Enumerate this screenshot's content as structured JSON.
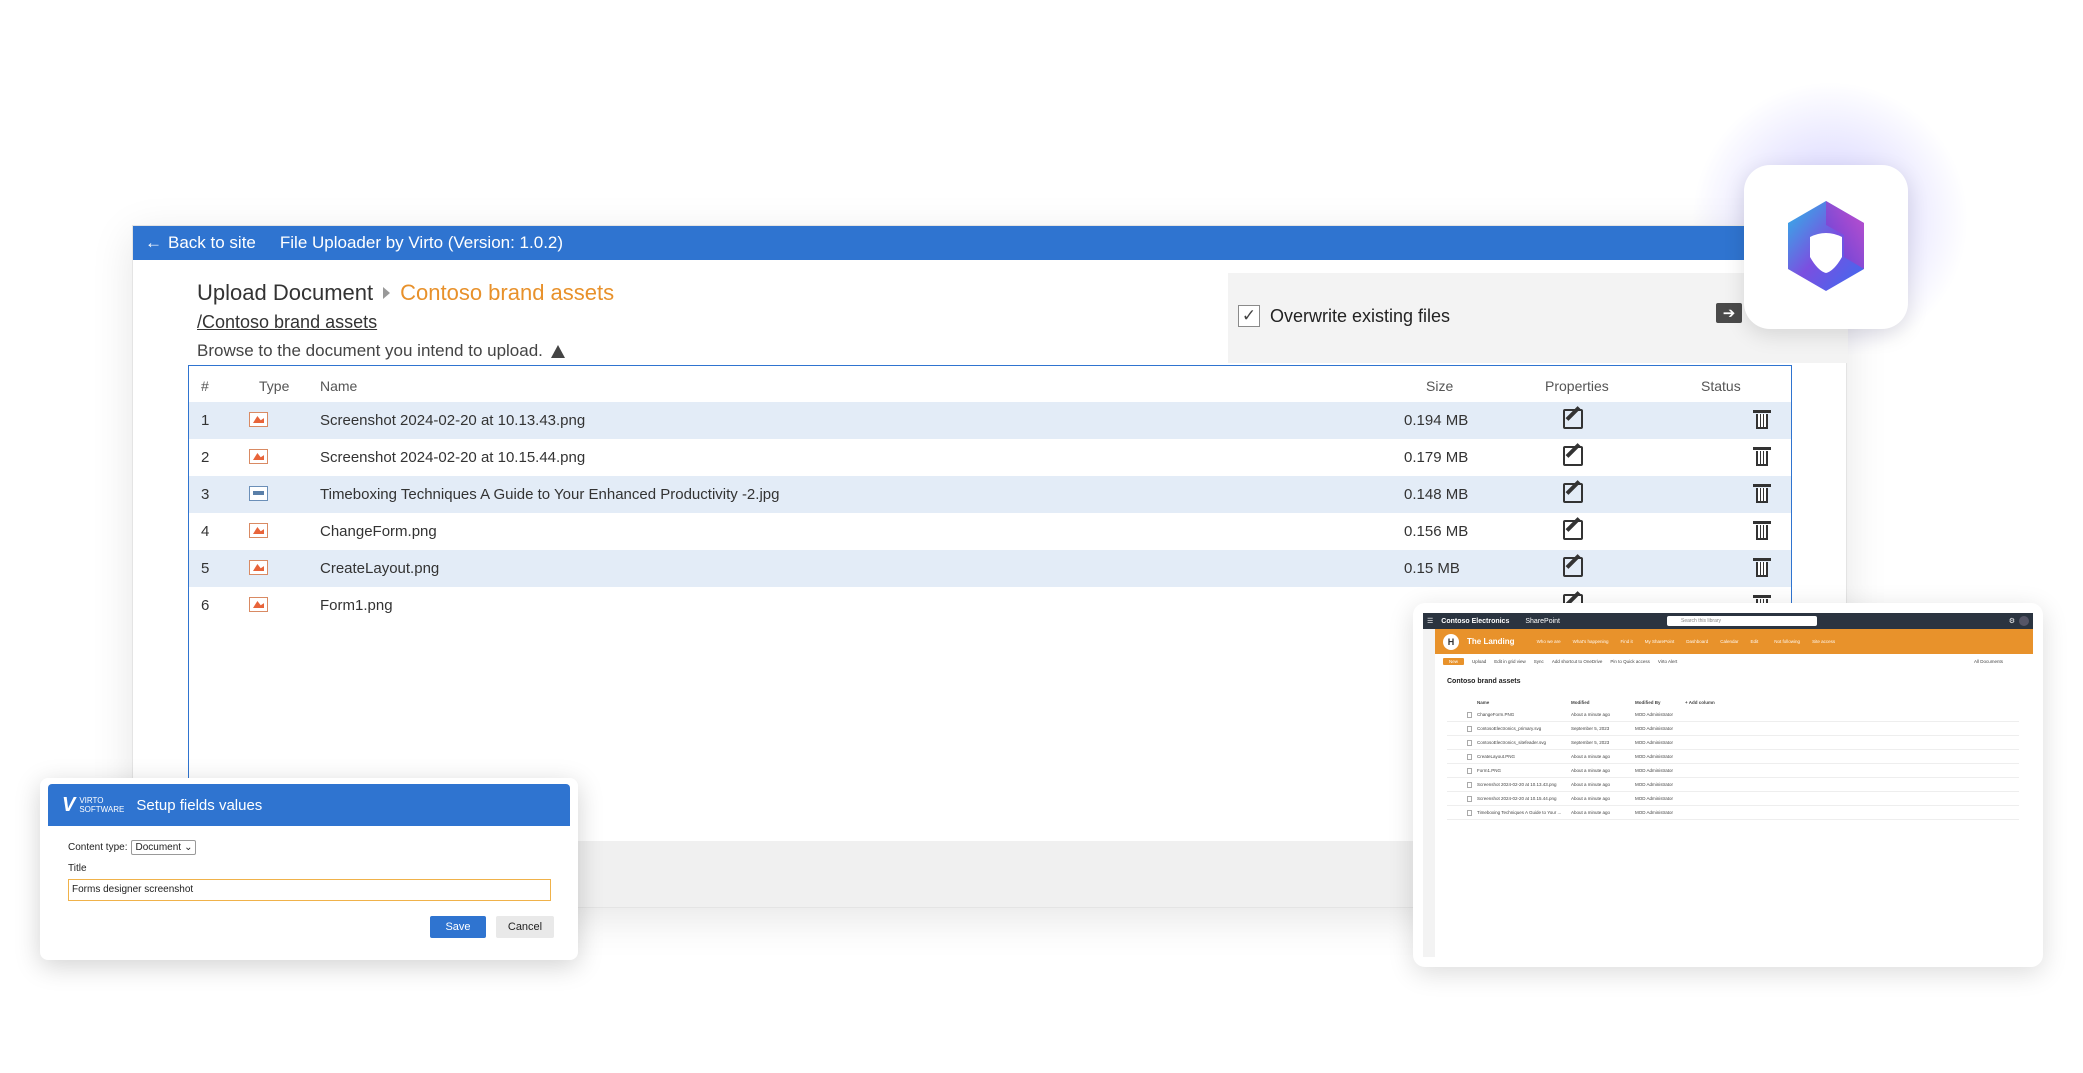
{
  "uploader": {
    "back_label": "Back to site",
    "app_title": "File Uploader by Virto (Version: 1.0.2)",
    "breadcrumb_root": "Upload Document",
    "breadcrumb_current": "Contoso brand assets",
    "path": "/Contoso brand assets",
    "hint": "Browse to the document you intend to upload.",
    "overwrite_label": "Overwrite existing files",
    "overwrite_checked": true,
    "columns": {
      "num": "#",
      "type": "Type",
      "name": "Name",
      "size": "Size",
      "properties": "Properties",
      "status": "Status"
    },
    "files": [
      {
        "num": "1",
        "name": "Screenshot 2024-02-20 at 10.13.43.png",
        "size": "0.194 MB",
        "type_icon": "png-image-icon"
      },
      {
        "num": "2",
        "name": "Screenshot 2024-02-20 at 10.15.44.png",
        "size": "0.179 MB",
        "type_icon": "png-image-icon"
      },
      {
        "num": "3",
        "name": "Timeboxing Techniques A Guide to Your Enhanced Productivity -2.jpg",
        "size": "0.148 MB",
        "type_icon": "jpg-image-icon"
      },
      {
        "num": "4",
        "name": "ChangeForm.png",
        "size": "0.156 MB",
        "type_icon": "png-image-icon"
      },
      {
        "num": "5",
        "name": "CreateLayout.png",
        "size": "0.15 MB",
        "type_icon": "png-image-icon"
      },
      {
        "num": "6",
        "name": "Form1.png",
        "size": "",
        "type_icon": "png-image-icon"
      }
    ]
  },
  "setup_dialog": {
    "brand_mark": "V",
    "brand_line1": "VIRTO",
    "brand_line2": "SOFTWARE",
    "title": "Setup fields values",
    "content_type_label": "Content type:",
    "content_type_value": "Document",
    "title_field_label": "Title",
    "title_field_value": "Forms designer screenshot",
    "save_label": "Save",
    "cancel_label": "Cancel"
  },
  "sharepoint": {
    "org_name": "Contoso Electronics",
    "app_name": "SharePoint",
    "search_placeholder": "Search this library",
    "site_initial": "H",
    "site_title": "The Landing",
    "nav_items": [
      "Who we are",
      "What's happening",
      "Find it",
      "My SharePoint",
      "Dashboard",
      "Calendar",
      "Edit"
    ],
    "follow_label": "Not following",
    "access_label": "Site access",
    "commands": [
      "New",
      "Upload",
      "Edit in grid view",
      "Sync",
      "Add shortcut to OneDrive",
      "Pin to Quick access",
      "Virto Alert"
    ],
    "view_label": "All Documents",
    "library_title": "Contoso brand assets",
    "columns": {
      "name": "Name",
      "modified": "Modified",
      "modified_by": "Modified By",
      "add": "+ Add column"
    },
    "rows": [
      {
        "name": "ChangeForm.PNG",
        "modified": "About a minute ago",
        "by": "MOD Administrator"
      },
      {
        "name": "ContosoElectronics_primary.svg",
        "modified": "September 5, 2023",
        "by": "MOD Administrator"
      },
      {
        "name": "ContosoElectronics_sitefeader.svg",
        "modified": "September 5, 2023",
        "by": "MOD Administrator"
      },
      {
        "name": "CreateLayout.PNG",
        "modified": "About a minute ago",
        "by": "MOD Administrator"
      },
      {
        "name": "Form1.PNG",
        "modified": "About a minute ago",
        "by": "MOD Administrator"
      },
      {
        "name": "Screenshot 2024-02-20 at 10.13.43.png",
        "modified": "About a minute ago",
        "by": "MOD Administrator"
      },
      {
        "name": "Screenshot 2024-02-20 at 10.15.44.png",
        "modified": "About a minute ago",
        "by": "MOD Administrator"
      },
      {
        "name": "Timeboxing Techniques A Guide to Your ...",
        "modified": "About a minute ago",
        "by": "MOD Administrator"
      }
    ]
  },
  "colors": {
    "primary_blue": "#2f74d0",
    "accent_orange": "#e8912b",
    "row_alt": "#e3ecf7",
    "logo_gradient": [
      "#2bb8e8",
      "#7b4fe0",
      "#c44fd0",
      "#3a6cf0"
    ]
  }
}
